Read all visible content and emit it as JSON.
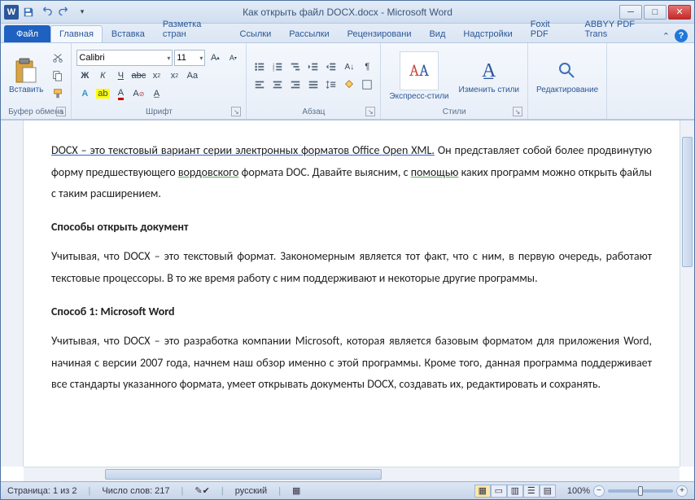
{
  "title": "Как открыть файл DOCX.docx - Microsoft Word",
  "tabs": {
    "file": "Файл",
    "home": "Главная",
    "insert": "Вставка",
    "layout": "Разметка стран",
    "refs": "Ссылки",
    "mail": "Рассылки",
    "review": "Рецензировани",
    "view": "Вид",
    "addins": "Надстройки",
    "foxit": "Foxit PDF",
    "abbyy": "ABBYY PDF Trans"
  },
  "ribbon": {
    "clipboard": {
      "label": "Буфер обмена",
      "paste": "Вставить"
    },
    "font": {
      "label": "Шрифт",
      "name": "Calibri",
      "size": "11"
    },
    "paragraph": {
      "label": "Абзац"
    },
    "styles": {
      "label": "Стили",
      "quick": "Экспресс-стили",
      "change": "Изменить стили"
    },
    "editing": {
      "label": "Редактирование"
    }
  },
  "document": {
    "p1_a": "DOCX – это текстовый вариант серии электронных форматов Office Open XML.",
    "p1_b": " Он представляет собой более продвинутую форму предшествующего ",
    "p1_c": "вордовского",
    "p1_d": " формата DOC. Давайте выясним, с ",
    "p1_e": "помощью",
    "p1_f": " каких программ можно открыть файлы с таким расширением.",
    "h1": "Способы открыть документ",
    "p2": "Учитывая, что DOCX – это текстовый формат. Закономерным является тот факт, что с ним, в первую очередь, работают текстовые процессоры. В то же время работу с ним поддерживают и некоторые другие программы.",
    "h2": "Способ 1: Microsoft Word",
    "p3": "Учитывая, что DOCX – это разработка компании Microsoft, которая является базовым форматом для приложения Word, начиная с версии 2007 года, начнем наш обзор именно с этой программы. Кроме того, данная программа поддерживает все стандарты указанного формата, умеет открывать документы DOCX, создавать их, редактировать и сохранять."
  },
  "status": {
    "page": "Страница: 1 из 2",
    "words": "Число слов: 217",
    "lang": "русский",
    "zoom": "100%"
  }
}
